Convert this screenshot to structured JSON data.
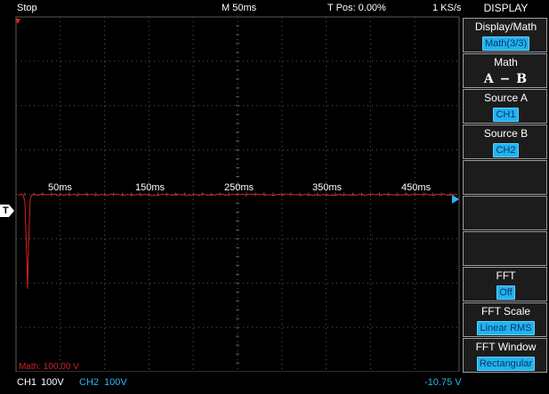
{
  "status": {
    "run_state": "Stop",
    "timebase": "M 50ms",
    "trigger_position": "T Pos: 0.00%",
    "sample_rate": "1 KS/s"
  },
  "plot": {
    "time_labels": [
      "50ms",
      "150ms",
      "250ms",
      "350ms",
      "450ms"
    ],
    "trigger_label": "T",
    "math_scale": "Math: 100.00 V",
    "trace_color": "#d82020",
    "grid_color": "#5a5a5a"
  },
  "footer": {
    "ch1_label": "CH1",
    "ch1_scale": "100V",
    "ch2_label": "CH2",
    "ch2_scale": "100V",
    "trigger_level": "-10.75 V",
    "ch2_color": "#22b8f0"
  },
  "menu": {
    "title": "DISPLAY",
    "items": [
      {
        "label": "Display/Math",
        "value": "Math(3/3)"
      },
      {
        "label": "Math",
        "value": "A − B"
      },
      {
        "label": "Source A",
        "value": "CH1"
      },
      {
        "label": "Source B",
        "value": "CH2"
      },
      {
        "label": "",
        "value": ""
      },
      {
        "label": "",
        "value": ""
      },
      {
        "label": "",
        "value": ""
      },
      {
        "label": "FFT",
        "value": "Off"
      },
      {
        "label": "FFT Scale",
        "value": "Linear RMS"
      },
      {
        "label": "FFT Window",
        "value": "Rectangular"
      }
    ]
  }
}
